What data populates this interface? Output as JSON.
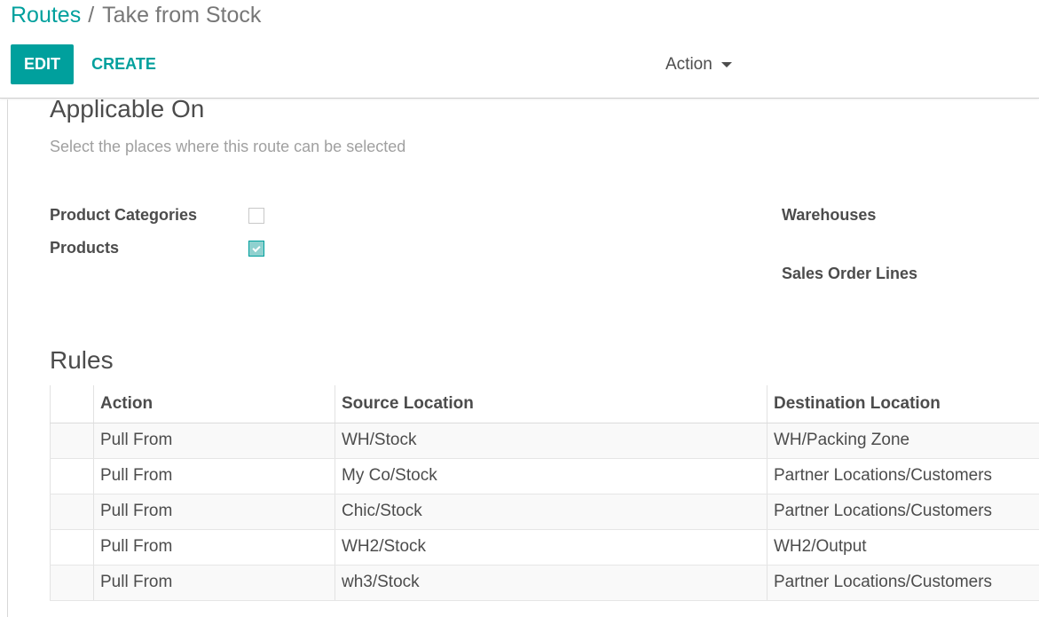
{
  "breadcrumb": {
    "parent": "Routes",
    "separator": "/",
    "current": "Take from Stock"
  },
  "toolbar": {
    "edit_label": "EDIT",
    "create_label": "CREATE",
    "action_label": "Action"
  },
  "applicable_on": {
    "title": "Applicable On",
    "help": "Select the places where this route can be selected",
    "fields": {
      "product_categories": {
        "label": "Product Categories",
        "checked": false
      },
      "products": {
        "label": "Products",
        "checked": true
      },
      "warehouses": {
        "label": "Warehouses"
      },
      "sales_order_lines": {
        "label": "Sales Order Lines"
      }
    }
  },
  "rules": {
    "title": "Rules",
    "columns": [
      "Action",
      "Source Location",
      "Destination Location"
    ],
    "rows": [
      [
        "Pull From",
        "WH/Stock",
        "WH/Packing Zone"
      ],
      [
        "Pull From",
        "My Co/Stock",
        "Partner Locations/Customers"
      ],
      [
        "Pull From",
        "Chic/Stock",
        "Partner Locations/Customers"
      ],
      [
        "Pull From",
        "WH2/Stock",
        "WH2/Output"
      ],
      [
        "Pull From",
        "wh3/Stock",
        "Partner Locations/Customers"
      ]
    ]
  },
  "colors": {
    "accent": "#00a09d",
    "text": "#4c4c4c",
    "muted": "#a0a0a0",
    "checkbox_checked_fill": "#8fd1cf"
  },
  "icons": {
    "action_caret": "caret-down-icon",
    "checkbox_check": "check-icon"
  }
}
